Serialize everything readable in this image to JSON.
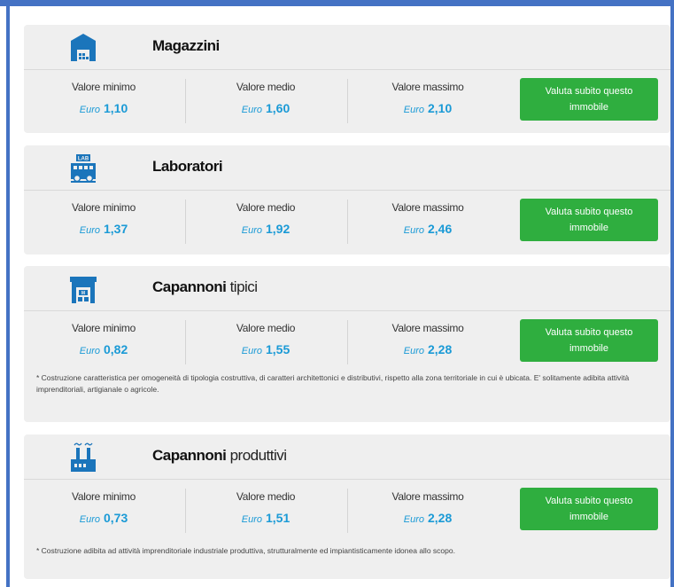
{
  "value_labels": {
    "min": "Valore minimo",
    "avg": "Valore medio",
    "max": "Valore massimo"
  },
  "currency": "Euro",
  "cta_label": "Valuta subito questo immobile",
  "cards": [
    {
      "title": "Magazzini",
      "subtitle": "",
      "icon": "warehouse-icon",
      "min": "1,10",
      "avg": "1,60",
      "max": "2,10",
      "note": ""
    },
    {
      "title": "Laboratori",
      "subtitle": "",
      "icon": "lab-icon",
      "min": "1,37",
      "avg": "1,92",
      "max": "2,46",
      "note": ""
    },
    {
      "title": "Capannoni",
      "subtitle": "tipici",
      "icon": "shed-icon",
      "min": "0,82",
      "avg": "1,55",
      "max": "2,28",
      "note": "* Costruzione caratteristica per omogeneità di tipologia costruttiva, di caratteri architettonici e distributivi, rispetto alla zona territoriale in cui è ubicata. E' solitamente adibita attività imprenditoriali, artigianale o agricole."
    },
    {
      "title": "Capannoni",
      "subtitle": "produttivi",
      "icon": "factory-icon",
      "min": "0,73",
      "avg": "1,51",
      "max": "2,28",
      "note": "* Costruzione adibita ad attività imprenditoriale industriale produttiva, strutturalmente ed impiantisticamente idonea allo scopo."
    }
  ],
  "colors": {
    "frame": "#4472c4",
    "card_bg": "#efefef",
    "value_blue": "#1a9ad6",
    "icon_blue": "#1b75bb",
    "cta_green": "#2fae3f"
  }
}
